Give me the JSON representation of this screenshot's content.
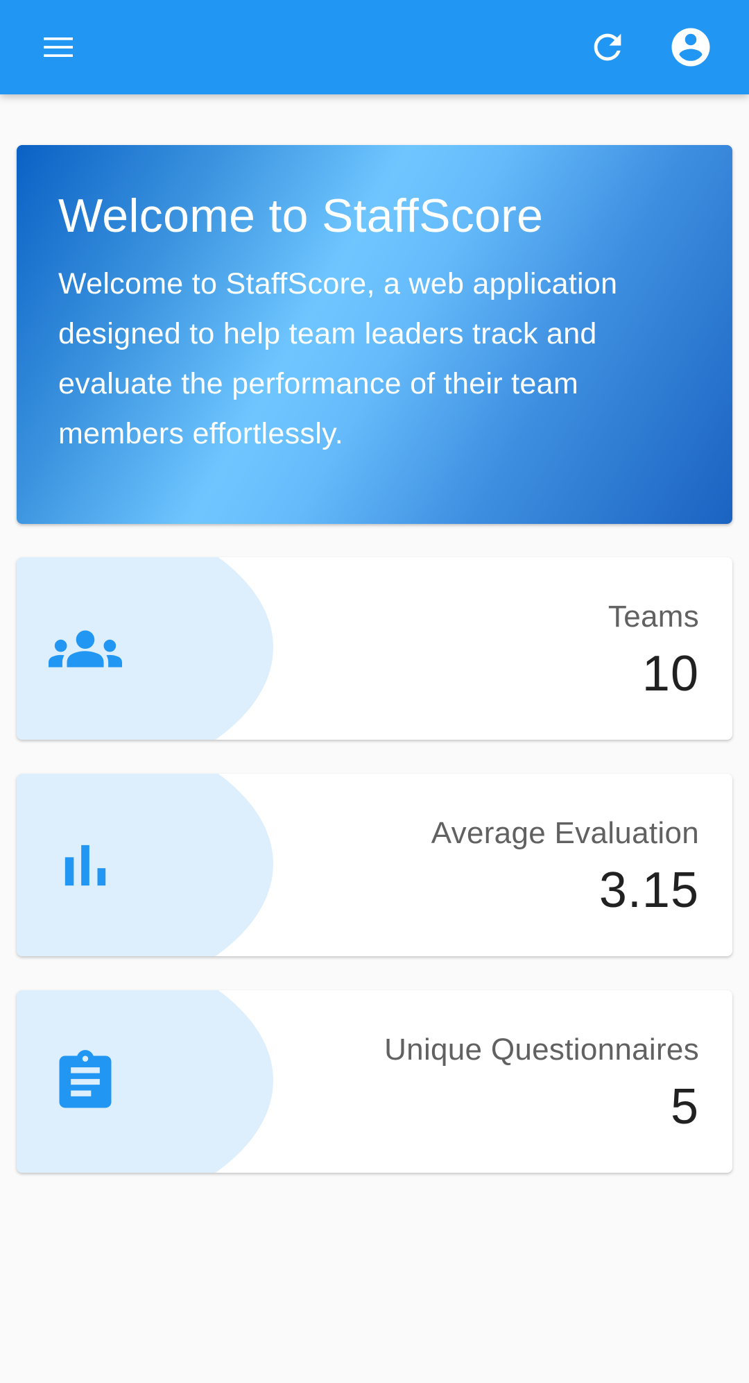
{
  "app_bar": {
    "background": "#2196f3",
    "icons": {
      "menu": "menu-icon",
      "refresh": "refresh-icon",
      "account": "account-circle-icon"
    }
  },
  "hero": {
    "title": "Welcome to StaffScore",
    "text": "Welcome to StaffScore, a web application designed to help team leaders track and evaluate the performance of their team members effortlessly."
  },
  "stats": [
    {
      "icon": "groups-icon",
      "label": "Teams",
      "value": "10"
    },
    {
      "icon": "bar-chart-icon",
      "label": "Average Evaluation",
      "value": "3.15"
    },
    {
      "icon": "clipboard-icon",
      "label": "Unique Questionnaires",
      "value": "5"
    }
  ],
  "colors": {
    "accent": "#2196f3",
    "card_highlight": "#ddeefc",
    "label_text": "#616161",
    "value_text": "#212121"
  }
}
